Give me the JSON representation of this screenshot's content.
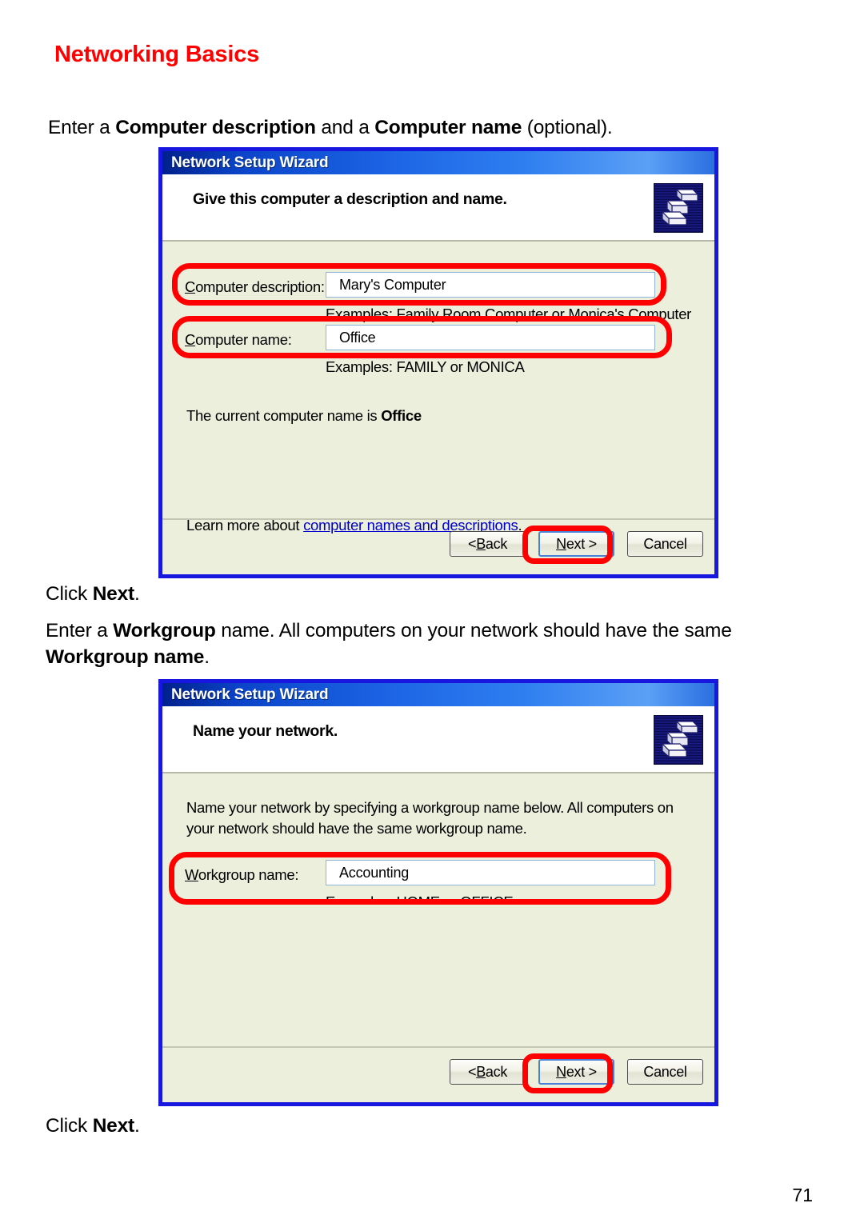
{
  "page": {
    "title": "Networking Basics",
    "number": "71",
    "title_color": "#fe0000"
  },
  "instructions": {
    "step1_part1": "Enter a ",
    "step1_bold1": "Computer description",
    "step1_part2": " and a ",
    "step1_bold2": "Computer name",
    "step1_part3": " (optional).",
    "click_next_1_part1": "Click ",
    "click_next_1_bold": "Next",
    "click_next_1_part2": ".",
    "step2_part1": "Enter a ",
    "step2_bold1": "Workgroup",
    "step2_part2": " name.  All computers on your network should have the same ",
    "step2_bold2": "Workgroup name",
    "step2_part3": ".",
    "click_next_2_part1": "Click ",
    "click_next_2_bold": "Next",
    "click_next_2_part2": "."
  },
  "dialog1": {
    "titlebar": "Network Setup Wizard",
    "header_title": "Give this computer a description and name.",
    "header_icon": "network-computers-icon",
    "fields": [
      {
        "label_accel": "C",
        "label_rest": "omputer description:",
        "value": "Mary's Computer",
        "hint": "Examples: Family Room Computer or Monica's Computer"
      },
      {
        "label_accel": "C",
        "label_rest": "omputer name:",
        "value": "Office",
        "hint": "Examples: FAMILY or MONICA"
      }
    ],
    "current_name_prefix": "The current computer name is ",
    "current_name_value": "Office",
    "learn_more_prefix": "Learn more about ",
    "learn_more_link": "computer names and descriptions",
    "learn_more_suffix": ".",
    "buttons": {
      "back_prefix": "< ",
      "back_accel": "B",
      "back_rest": "ack",
      "next_accel": "N",
      "next_rest": "ext >",
      "cancel": "Cancel"
    }
  },
  "dialog2": {
    "titlebar": "Network Setup Wizard",
    "header_title": "Name your network.",
    "header_icon": "network-computers-icon",
    "paragraph": "Name your network by specifying a workgroup name below. All computers on your network should have the same workgroup name.",
    "field": {
      "label_accel": "W",
      "label_rest": "orkgroup name:",
      "value": "Accounting",
      "hint": "Examples: HOME or OFFICE"
    },
    "buttons": {
      "back_prefix": "< ",
      "back_accel": "B",
      "back_rest": "ack",
      "next_accel": "N",
      "next_rest": "ext >",
      "cancel": "Cancel"
    }
  },
  "annotations": {
    "highlight_color": "#ff0000",
    "boxes": [
      "computer-description-field",
      "computer-name-field",
      "next-button-1",
      "workgroup-name-field",
      "next-button-2"
    ]
  }
}
